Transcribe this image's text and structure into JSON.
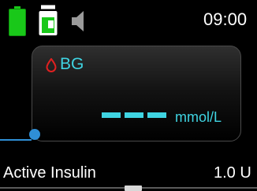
{
  "status_bar": {
    "battery_icon": "battery-full-icon",
    "reservoir_icon": "insulin-reservoir-icon",
    "sound_icon": "speaker-icon",
    "time": "09:00",
    "battery_color": "#19c819"
  },
  "bg_card": {
    "drop_icon": "blood-drop-icon",
    "label": "BG",
    "value_placeholder": "---",
    "unit": "mmol/L",
    "accent_color": "#3fd4e2",
    "drop_color": "#e02020"
  },
  "selection_indicator_color": "#2f8fd6",
  "active_insulin": {
    "label": "Active Insulin",
    "value": "1.0 U"
  }
}
